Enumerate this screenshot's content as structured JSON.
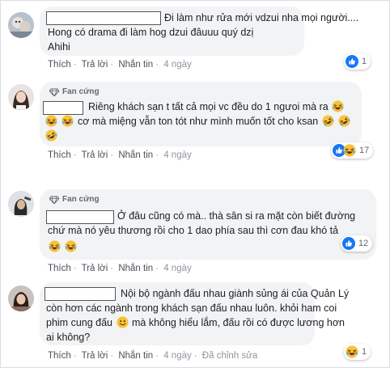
{
  "badge_label": "Fan cứng",
  "comments": [
    {
      "lines": [
        "Đi làm như rửa mới vdzui nha mọi người....",
        "Hong có drama đi làm hog dzui đâuuu quý dzị",
        "Ahihi"
      ],
      "actions": [
        "Thích",
        "Trả lời",
        "Nhắn tin"
      ],
      "time": "4 ngày",
      "reaction_count": "1",
      "reaction_icons": [
        "like-icon"
      ]
    },
    {
      "lines": [
        "Riêng khách sạn t tất cả mọi vc đều do 1 ngưoi mà ra",
        "cơ mà miệng vẫn ton tót như mình muốn tốt cho ksan"
      ],
      "actions": [
        "Thích",
        "Trả lời",
        "Nhắn tin"
      ],
      "time": "4 ngày",
      "reaction_count": "17",
      "reaction_icons": [
        "like-icon",
        "haha-icon"
      ]
    },
    {
      "lines": [
        "Ở đâu cũng có mà.. thà sân si ra mặt còn biết đường",
        "chứ mà nó yêu thương rồi cho 1 dao phía sau thì cơn đau khó tả"
      ],
      "actions": [
        "Thích",
        "Trả lời",
        "Nhắn tin"
      ],
      "time": "4 ngày",
      "reaction_count": "12",
      "reaction_icons": [
        "like-icon"
      ]
    },
    {
      "lines": [
        "Nội bộ ngành đấu nhau giành sủng ái của Quản Lý",
        "còn hơn các ngành trong khách sạn đấu nhau luôn. khỏi ham coi",
        "phim cung đấu",
        "mà không hiểu lắm, đấu rồi có được lương hơn",
        "ai không?"
      ],
      "actions": [
        "Thích",
        "Trả lời",
        "Nhắn tin"
      ],
      "time": "4 ngày",
      "edited_label": "Đã chỉnh sửa",
      "reaction_count": "1",
      "reaction_icons": [
        "haha-icon"
      ]
    }
  ],
  "colors": {
    "like_blue": "#1877f2",
    "haha_yellow": "#f7c339",
    "bubble_bg": "#f2f3f5"
  }
}
